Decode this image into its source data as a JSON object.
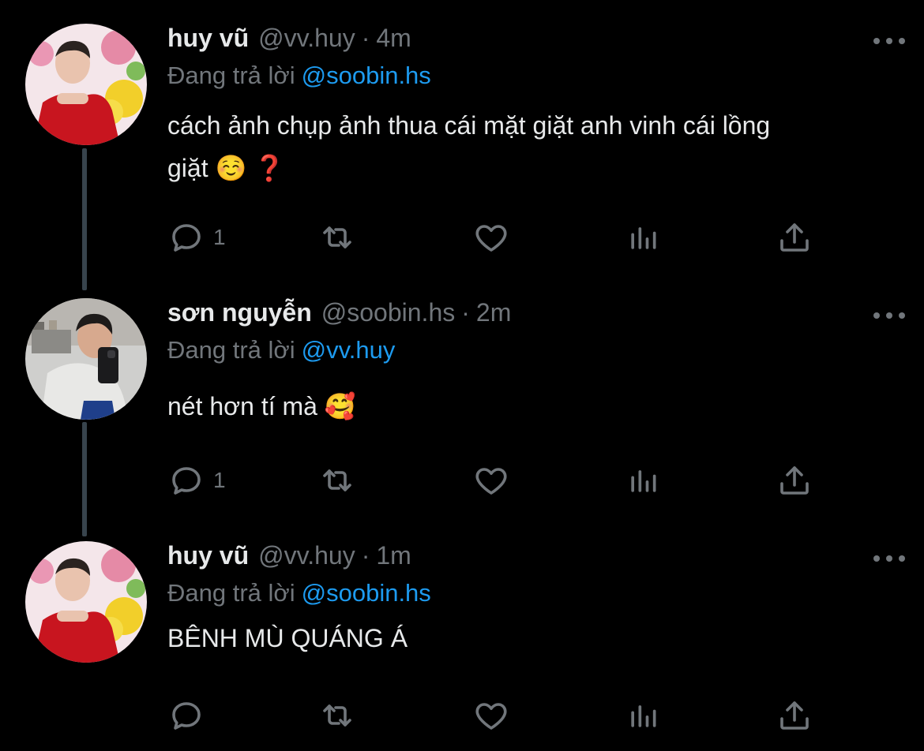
{
  "tweets": [
    {
      "display_name": "huy vũ",
      "handle": "@vv.huy",
      "separator": "·",
      "time": "4m",
      "reply_label": "Đang trả lời",
      "reply_to": "@soobin.hs",
      "text_line1": "cách ảnh chụp ảnh thua cái mặt giặt anh vinh cái lồng",
      "text_line2": "giặt ☺️ ❓",
      "reply_count": "1",
      "avatar": "red-shirt-flowers-avatar"
    },
    {
      "display_name": "sơn nguyễn",
      "handle": "@soobin.hs",
      "separator": "·",
      "time": "2m",
      "reply_label": "Đang trả lời",
      "reply_to": "@vv.huy",
      "text_line1": "nét hơn tí mà 🥰",
      "text_line2": "",
      "reply_count": "1",
      "avatar": "mirror-selfie-avatar"
    },
    {
      "display_name": "huy vũ",
      "handle": "@vv.huy",
      "separator": "·",
      "time": "1m",
      "reply_label": "Đang trả lời",
      "reply_to": "@soobin.hs",
      "text_line1": "BÊNH MÙ QUÁNG Á",
      "text_line2": "",
      "reply_count": "",
      "avatar": "red-shirt-flowers-avatar"
    }
  ],
  "icons": {
    "reply": "reply-icon",
    "retweet": "retweet-icon",
    "like": "heart-icon",
    "views": "views-icon",
    "share": "share-icon",
    "more": "more-icon"
  },
  "colors": {
    "background": "#000000",
    "text": "#e7e9ea",
    "muted": "#71767b",
    "accent": "#1d9bf0",
    "thread_line": "#38444d"
  }
}
